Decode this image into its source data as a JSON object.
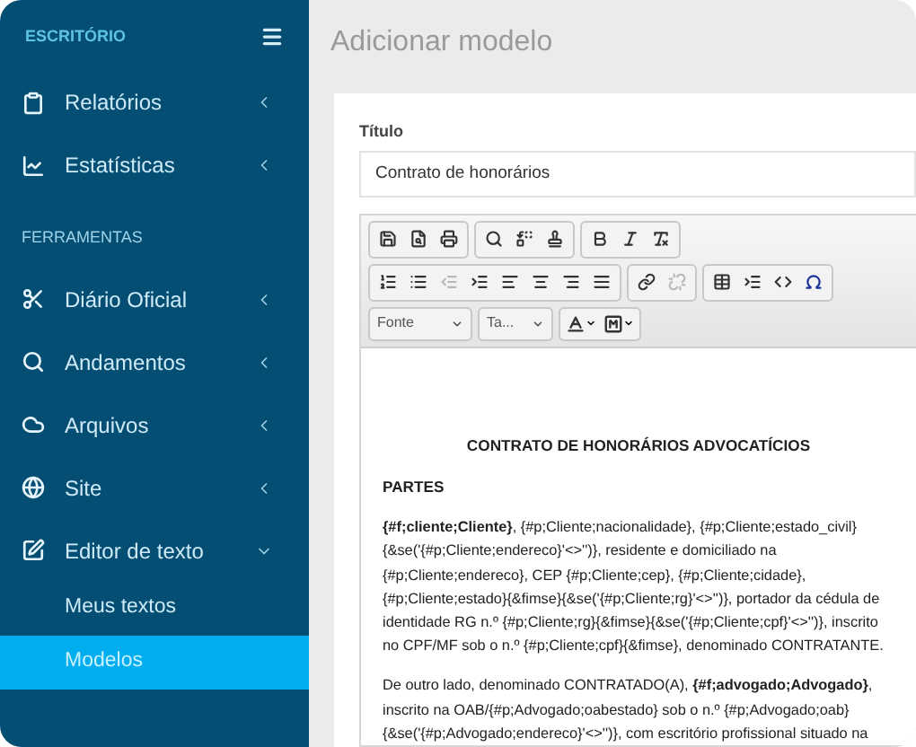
{
  "sidebar": {
    "title": "ESCRITÓRIO",
    "sections": [
      {
        "items": [
          {
            "label": "Relatórios",
            "expanded": false
          },
          {
            "label": "Estatísticas",
            "expanded": false
          }
        ]
      },
      {
        "heading": "FERRAMENTAS",
        "items": [
          {
            "label": "Diário Oficial",
            "expanded": false
          },
          {
            "label": "Andamentos",
            "expanded": false
          },
          {
            "label": "Arquivos",
            "expanded": false
          },
          {
            "label": "Site",
            "expanded": false
          },
          {
            "label": "Editor de texto",
            "expanded": true,
            "children": [
              {
                "label": "Meus textos",
                "selected": false
              },
              {
                "label": "Modelos",
                "selected": true
              }
            ]
          }
        ]
      }
    ]
  },
  "page_title": "Adicionar modelo",
  "form": {
    "title_label": "Título",
    "title_value": "Contrato de honorários",
    "toolbar": {
      "icon_rows": [
        [
          [
            {
              "disabled": false
            },
            {
              "disabled": false
            },
            {
              "disabled": false
            }
          ],
          [
            {
              "disabled": false
            },
            {
              "disabled": false
            },
            {
              "disabled": false
            }
          ],
          [
            {
              "disabled": false
            },
            {
              "disabled": false
            },
            {
              "disabled": false
            }
          ]
        ],
        [
          [
            {
              "disabled": false
            },
            {
              "disabled": false
            },
            {
              "disabled": true
            },
            {
              "disabled": false
            },
            {
              "disabled": false
            },
            {
              "disabled": false
            },
            {
              "disabled": false
            },
            {
              "disabled": false
            }
          ],
          [
            {
              "disabled": false
            },
            {
              "disabled": true
            }
          ],
          [
            {
              "disabled": false
            },
            {
              "disabled": false
            },
            {
              "disabled": false
            },
            {
              "disabled": false
            }
          ]
        ]
      ],
      "font_select": "Fonte",
      "size_select": "Ta..."
    },
    "document": {
      "heading": "CONTRATO DE HONORÁRIOS ADVOCATÍCIOS",
      "section": "PARTES",
      "paragraphs": [
        "**{#f;cliente;Cliente}**, {#p;Cliente;nacionalidade}, {#p;Cliente;estado_civil} {&se('{#p;Cliente;endereco}'<>'')}, residente e domiciliado na {#p;Cliente;endereco}, CEP {#p;Cliente;cep}, {#p;Cliente;cidade}, {#p;Cliente;estado}{&fimse}{&se('{#p;Cliente;rg}'<>'')}, portador da cédula de identidade RG n.º {#p;Cliente;rg}{&fimse}{&se('{#p;Cliente;cpf}'<>'')}, inscrito no CPF/MF sob o n.º {#p;Cliente;cpf}{&fimse}, denominado CONTRATANTE.",
        "De outro lado, denominado CONTRATADO(A), **{#f;advogado;Advogado}**, inscrito na OAB/{#p;Advogado;oabestado} sob o n.º {#p;Advogado;oab} {&se('{#p;Advogado;endereco}'<>'')}, com escritório profissional situado na"
      ]
    }
  }
}
